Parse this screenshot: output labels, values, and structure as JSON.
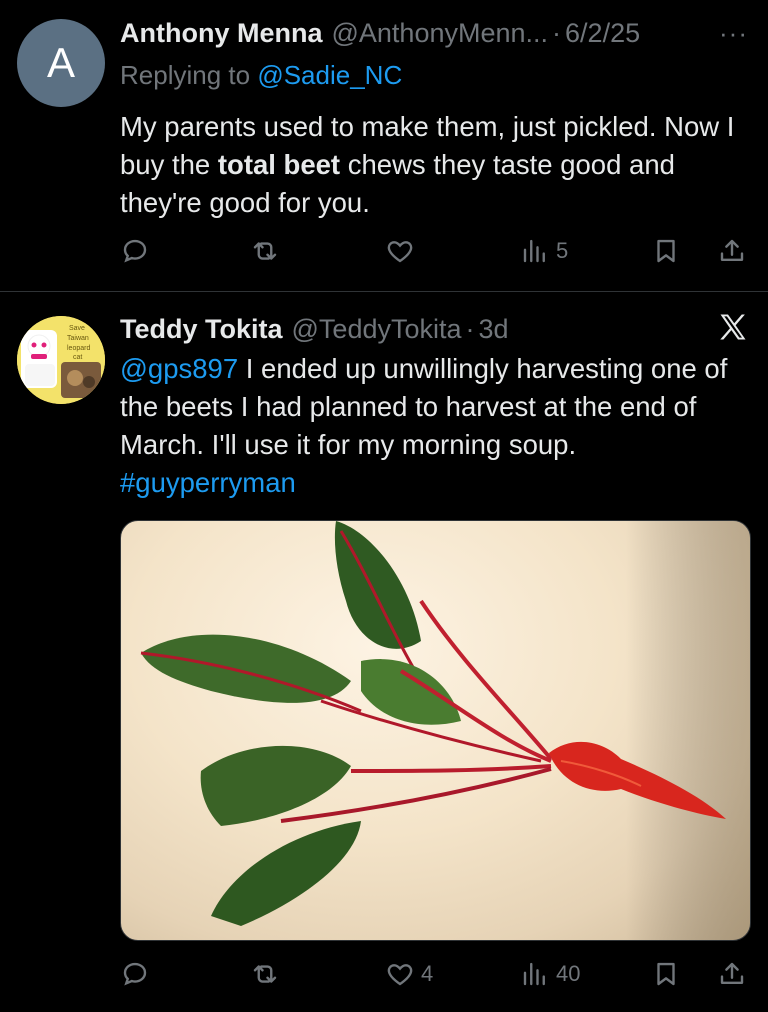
{
  "tweets": [
    {
      "avatar_letter": "A",
      "name": "Anthony Menna",
      "handle": "@AnthonyMenn...",
      "separator": "·",
      "time": "6/2/25",
      "more": "···",
      "replying_prefix": "Replying to",
      "replying_handle": "@Sadie_NC",
      "text_part1": "My parents used to make them, just pickled. Now I buy the ",
      "text_bold": "total beet",
      "text_part2": " chews they taste good and they're good for you.",
      "actions": {
        "reply": "",
        "repost": "",
        "like": "",
        "views": "5"
      }
    },
    {
      "name": "Teddy Tokita",
      "handle": "@TeddyTokita",
      "separator": "·",
      "time": "3d",
      "mention": "@gps897",
      "text": " I ended up unwillingly harvesting one of the beets I had planned to harvest at the end of March. I'll use it for my morning soup.",
      "hashtag": "#guyperryman",
      "media_alt": "Harvested beet with leaves",
      "actions": {
        "reply": "",
        "repost": "",
        "like": "4",
        "views": "40"
      }
    }
  ],
  "avatar_b_text": [
    "Save",
    "Taiwan",
    "leopard",
    "cat"
  ],
  "colors": {
    "background": "#000000",
    "text": "#e7e9ea",
    "muted": "#71767b",
    "link": "#1d9bf0",
    "divider": "#2f3336"
  }
}
